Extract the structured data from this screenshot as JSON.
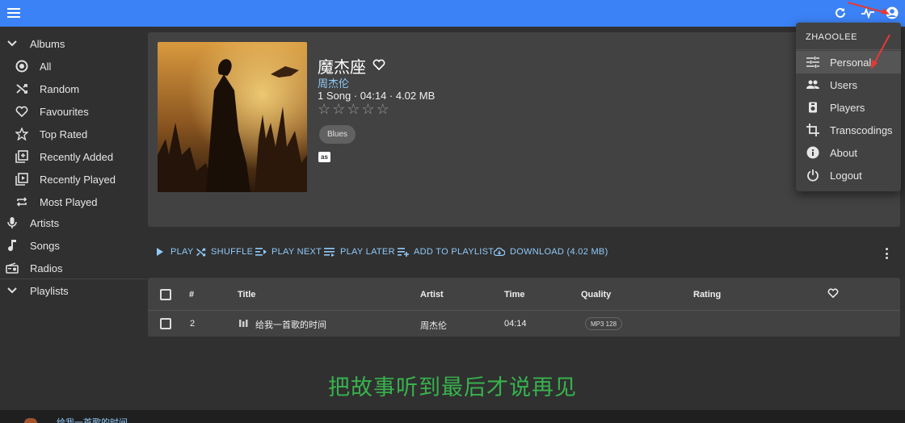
{
  "sidebar": {
    "items": [
      {
        "label": "Albums",
        "icon": "chevron-down-icon"
      },
      {
        "label": "All",
        "icon": "radio-target-icon"
      },
      {
        "label": "Random",
        "icon": "shuffle-icon"
      },
      {
        "label": "Favourites",
        "icon": "heart-outline-icon"
      },
      {
        "label": "Top Rated",
        "icon": "star-outline-icon"
      },
      {
        "label": "Recently Added",
        "icon": "library-add-icon"
      },
      {
        "label": "Recently Played",
        "icon": "video-library-icon"
      },
      {
        "label": "Most Played",
        "icon": "repeat-icon"
      },
      {
        "label": "Artists",
        "icon": "microphone-icon"
      },
      {
        "label": "Songs",
        "icon": "music-note-icon"
      },
      {
        "label": "Radios",
        "icon": "radio-icon"
      },
      {
        "label": "Playlists",
        "icon": "chevron-down-icon"
      }
    ]
  },
  "album": {
    "title": "魔杰座",
    "artist": "周杰伦",
    "meta": "1 Song · 04:14 · 4.02 MB",
    "rating_max": 5,
    "rating": 0,
    "genre": "Blues",
    "lastfm_label": "as"
  },
  "actions": {
    "play": "PLAY",
    "shuffle": "SHUFFLE",
    "play_next": "PLAY NEXT",
    "play_later": "PLAY LATER",
    "add_to_playlist": "ADD TO PLAYLIST",
    "download": "DOWNLOAD (4.02 MB)"
  },
  "table": {
    "headers": {
      "num": "#",
      "title": "Title",
      "artist": "Artist",
      "time": "Time",
      "quality": "Quality",
      "rating": "Rating"
    },
    "rows": [
      {
        "num": "2",
        "title": "给我一首歌的时间",
        "artist": "周杰伦",
        "time": "04:14",
        "quality": "MP3 128"
      }
    ]
  },
  "lyric": "把故事听到最后才说再见",
  "player": {
    "now_playing": "给我一首歌的时间"
  },
  "user_menu": {
    "username": "ZHAOOLEE",
    "items": [
      {
        "label": "Personal",
        "icon": "tune-icon"
      },
      {
        "label": "Users",
        "icon": "people-icon"
      },
      {
        "label": "Players",
        "icon": "speaker-icon"
      },
      {
        "label": "Transcodings",
        "icon": "crop-icon"
      },
      {
        "label": "About",
        "icon": "info-icon"
      },
      {
        "label": "Logout",
        "icon": "power-icon"
      }
    ]
  },
  "colors": {
    "appbar": "#3b82f6",
    "accent_link": "#90caf9",
    "lyric": "#37b24d",
    "annotation_arrow": "#e53935"
  }
}
